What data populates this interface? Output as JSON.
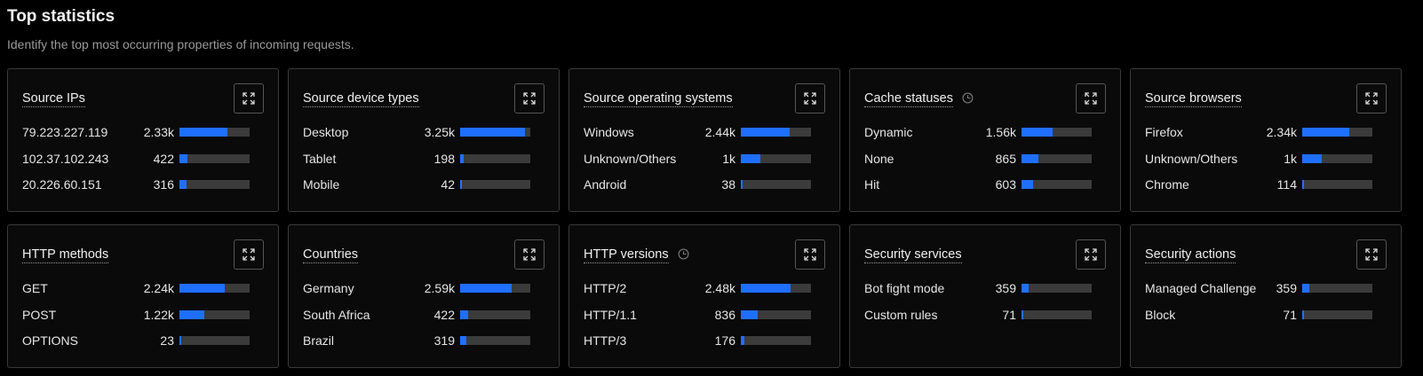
{
  "header": {
    "title": "Top statistics",
    "subtitle": "Identify the top most occurring properties of incoming requests."
  },
  "colors": {
    "accent": "#1f6fff",
    "track": "#3b3b3b",
    "border": "#3a3a3a"
  },
  "cards": [
    {
      "title": "Source IPs",
      "icon": "expand-icon",
      "history_icon": false,
      "rows": [
        {
          "label": "79.223.227.119",
          "value": "2.33k",
          "fraction": 0.68
        },
        {
          "label": "102.37.102.243",
          "value": "422",
          "fraction": 0.12
        },
        {
          "label": "20.226.60.151",
          "value": "316",
          "fraction": 0.1
        }
      ]
    },
    {
      "title": "Source device types",
      "icon": "expand-icon",
      "history_icon": false,
      "rows": [
        {
          "label": "Desktop",
          "value": "3.25k",
          "fraction": 0.93
        },
        {
          "label": "Tablet",
          "value": "198",
          "fraction": 0.05
        },
        {
          "label": "Mobile",
          "value": "42",
          "fraction": 0.015
        }
      ]
    },
    {
      "title": "Source operating systems",
      "icon": "expand-icon",
      "history_icon": false,
      "rows": [
        {
          "label": "Windows",
          "value": "2.44k",
          "fraction": 0.7
        },
        {
          "label": "Unknown/Others",
          "value": "1k",
          "fraction": 0.28
        },
        {
          "label": "Android",
          "value": "38",
          "fraction": 0.015
        }
      ]
    },
    {
      "title": "Cache statuses",
      "icon": "expand-icon",
      "history_icon": true,
      "rows": [
        {
          "label": "Dynamic",
          "value": "1.56k",
          "fraction": 0.44
        },
        {
          "label": "None",
          "value": "865",
          "fraction": 0.24
        },
        {
          "label": "Hit",
          "value": "603",
          "fraction": 0.16
        }
      ]
    },
    {
      "title": "Source browsers",
      "icon": "expand-icon",
      "history_icon": false,
      "rows": [
        {
          "label": "Firefox",
          "value": "2.34k",
          "fraction": 0.67
        },
        {
          "label": "Unknown/Others",
          "value": "1k",
          "fraction": 0.28
        },
        {
          "label": "Chrome",
          "value": "114",
          "fraction": 0.03
        }
      ]
    },
    {
      "title": "HTTP methods",
      "icon": "expand-icon",
      "history_icon": false,
      "rows": [
        {
          "label": "GET",
          "value": "2.24k",
          "fraction": 0.65
        },
        {
          "label": "POST",
          "value": "1.22k",
          "fraction": 0.35
        },
        {
          "label": "OPTIONS",
          "value": "23",
          "fraction": 0.01
        }
      ]
    },
    {
      "title": "Countries",
      "icon": "expand-icon",
      "history_icon": false,
      "rows": [
        {
          "label": "Germany",
          "value": "2.59k",
          "fraction": 0.74
        },
        {
          "label": "South Africa",
          "value": "422",
          "fraction": 0.12
        },
        {
          "label": "Brazil",
          "value": "319",
          "fraction": 0.09
        }
      ]
    },
    {
      "title": "HTTP versions",
      "icon": "expand-icon",
      "history_icon": true,
      "rows": [
        {
          "label": "HTTP/2",
          "value": "2.48k",
          "fraction": 0.71
        },
        {
          "label": "HTTP/1.1",
          "value": "836",
          "fraction": 0.24
        },
        {
          "label": "HTTP/3",
          "value": "176",
          "fraction": 0.05
        }
      ]
    },
    {
      "title": "Security services",
      "icon": "expand-icon",
      "history_icon": false,
      "rows": [
        {
          "label": "Bot fight mode",
          "value": "359",
          "fraction": 0.1
        },
        {
          "label": "Custom rules",
          "value": "71",
          "fraction": 0.02
        }
      ]
    },
    {
      "title": "Security actions",
      "icon": "expand-icon",
      "history_icon": false,
      "rows": [
        {
          "label": "Managed Challenge",
          "value": "359",
          "fraction": 0.1
        },
        {
          "label": "Block",
          "value": "71",
          "fraction": 0.02
        }
      ]
    }
  ]
}
